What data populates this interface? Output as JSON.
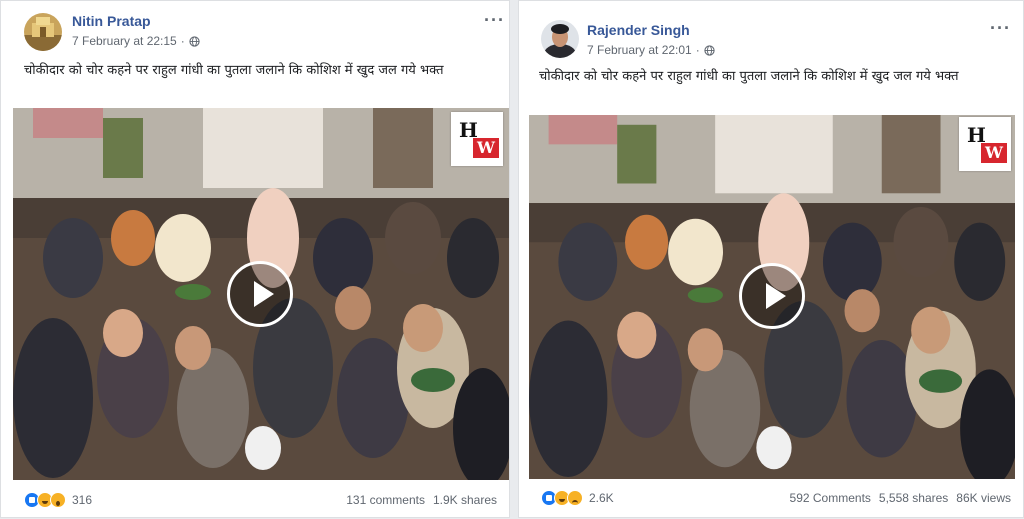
{
  "posts": [
    {
      "author": "Nitin Pratap",
      "timestamp": "7 February at 22:15",
      "caption": "चोकीदार को चोर कहने पर राहुल गांधी का पुतला जलाने कि कोशिश में खुद जल गये भक्त",
      "logo_h": "H",
      "logo_w": "W",
      "reactions": [
        "like",
        "haha",
        "wow"
      ],
      "reaction_count": "316",
      "comments": "131 comments",
      "shares": "1.9K shares",
      "views": ""
    },
    {
      "author": "Rajender Singh",
      "timestamp": "7 February at 22:01",
      "caption": "चोकीदार को चोर कहने पर राहुल गांधी का पुतला जलाने कि कोशिश में खुद जल गये भक्त",
      "logo_h": "H",
      "logo_w": "W",
      "reactions": [
        "like",
        "haha",
        "sad"
      ],
      "reaction_count": "2.6K",
      "comments": "592 Comments",
      "shares": "5,558 shares",
      "views": "86K views"
    }
  ],
  "colors": {
    "author_link": "#385898",
    "meta_text": "#606770",
    "like_blue": "#1877f2",
    "emoji_yellow": "#f7b125",
    "logo_red": "#d7262e"
  }
}
